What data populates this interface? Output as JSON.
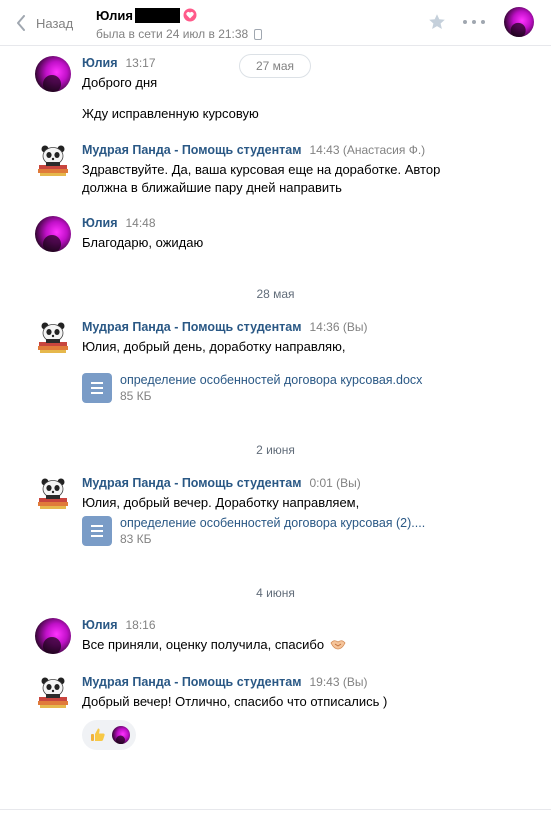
{
  "header": {
    "back_label": "Назад",
    "peer_name": "Юлия",
    "peer_status": "была в сети 24 июл в 21:38"
  },
  "dates": {
    "d1": "27 мая",
    "d2": "28 мая",
    "d3": "2 июня",
    "d4": "4 июня"
  },
  "messages": [
    {
      "author": "Юлия",
      "time": "13:17",
      "lines": [
        "Доброго дня",
        "Жду исправленную курсовую"
      ]
    },
    {
      "author": "Мудрая Панда - Помощь студентам",
      "time": "14:43 (Анастасия Ф.)",
      "lines": [
        "Здравствуйте. Да, ваша курсовая еще на доработке. Автор",
        "должна в ближайшие пару дней направить"
      ]
    },
    {
      "author": "Юлия",
      "time": "14:48",
      "lines": [
        "Благодарю, ожидаю"
      ]
    },
    {
      "author": "Мудрая Панда - Помощь студентам",
      "time": "14:36 (Вы)",
      "lines": [
        "Юлия, добрый день, доработку направляю,"
      ],
      "doc": {
        "title": "определение особенностей договора курсовая.docx",
        "size": "85 КБ"
      }
    },
    {
      "author": "Мудрая Панда - Помощь студентам",
      "time": "0:01 (Вы)",
      "lines": [
        "Юлия, добрый вечер. Доработку направляем,"
      ],
      "doc": {
        "title": "определение особенностей договора курсовая (2)....",
        "size": "83 КБ"
      }
    },
    {
      "author": "Юлия",
      "time": "18:16",
      "lines": [
        "Все приняли, оценку получила, спасибо"
      ]
    },
    {
      "author": "Мудрая Панда - Помощь студентам",
      "time": "19:43 (Вы)",
      "lines": [
        "Добрый вечер! Отлично, спасибо что отписались )"
      ]
    }
  ],
  "icons": {
    "back": "chevron-left-icon",
    "star": "star-icon",
    "more": "more-horizontal-icon",
    "doc": "document-icon",
    "reaction": "thumbs-up-icon"
  },
  "colors": {
    "link": "#2a5885",
    "muted": "#828282",
    "doc_icon": "#7a9cc7"
  }
}
